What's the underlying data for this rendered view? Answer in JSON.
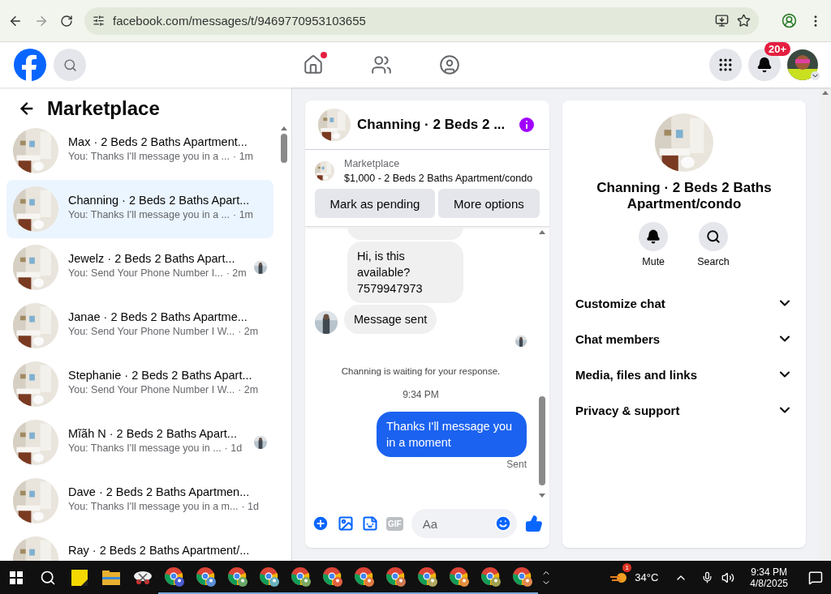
{
  "browser": {
    "url": "facebook.com/messages/t/9469770953103655"
  },
  "header": {
    "nav": [
      {
        "kind": "home",
        "selected": false,
        "dot": true
      },
      {
        "kind": "friends",
        "selected": false,
        "dot": false
      },
      {
        "kind": "groups",
        "selected": false,
        "dot": false
      }
    ],
    "notification_badge": "20+"
  },
  "sidebar": {
    "title": "Marketplace",
    "conversations": [
      {
        "name": "Max · 2 Beds 2 Baths Apartment...",
        "preview": "You: Thanks I'll message you in a ...",
        "time": "· 1m",
        "selected": false,
        "seen": false
      },
      {
        "name": "Channing · 2 Beds 2 Baths Apart...",
        "preview": "You: Thanks I'll message you in a ...",
        "time": "· 1m",
        "selected": true,
        "seen": false
      },
      {
        "name": "Jewelz · 2 Beds 2 Baths Apart...",
        "preview": "You: Send Your Phone Number I...",
        "time": "· 2m",
        "selected": false,
        "seen": true
      },
      {
        "name": "Janae · 2 Beds 2 Baths Apartme...",
        "preview": "You: Send Your Phone Number I W...",
        "time": "· 2m",
        "selected": false,
        "seen": false
      },
      {
        "name": "Stephanie · 2 Beds 2 Baths Apart...",
        "preview": "You: Send Your Phone Number I W...",
        "time": "· 2m",
        "selected": false,
        "seen": false
      },
      {
        "name": "Mĩãh N · 2 Beds 2 Baths Apart...",
        "preview": "You: Thanks I'll message you in ...",
        "time": "· 1d",
        "selected": false,
        "seen": true
      },
      {
        "name": "Dave · 2 Beds 2 Baths Apartmen...",
        "preview": "You: Thanks I'll message you in a m...",
        "time": "· 1d",
        "selected": false,
        "seen": false
      },
      {
        "name": "Ray · 2 Beds 2 Baths Apartment/...",
        "selected": false,
        "seen": false
      }
    ]
  },
  "chat": {
    "title": "Channing · 2 Beds 2 ...",
    "listing": {
      "label": "Marketplace",
      "text": "$1,000 - 2 Beds 2 Baths Apartment/condo"
    },
    "actions": [
      "Mark as pending",
      "More options"
    ],
    "messages": [
      {
        "kind": "partial"
      },
      {
        "kind": "incoming",
        "text": "Hi, is this available? 7579947973",
        "avatar": false
      },
      {
        "kind": "incoming",
        "text": "Message sent",
        "avatar": true
      },
      {
        "kind": "seen"
      },
      {
        "kind": "system",
        "text": "Channing is waiting for your response."
      },
      {
        "kind": "time",
        "text": "9:34 PM"
      },
      {
        "kind": "outgoing",
        "text": "Thanks I'll message you in a moment"
      },
      {
        "kind": "status",
        "text": "Sent"
      }
    ],
    "composer": {
      "gif": "GIF",
      "placeholder": "Aa"
    }
  },
  "details": {
    "title": "Channing · 2 Beds 2 Baths Apartment/condo",
    "actions": [
      {
        "kind": "mute",
        "label": "Mute"
      },
      {
        "kind": "search",
        "label": "Search"
      }
    ],
    "sections": [
      {
        "label": "Customize chat",
        "expanded": false
      },
      {
        "label": "Chat members",
        "expanded": false
      },
      {
        "label": "Media, files and links",
        "expanded": false
      },
      {
        "label": "Privacy & support",
        "expanded": false
      }
    ]
  },
  "taskbar": {
    "weather_badge": "1",
    "temperature": "34°C",
    "time": "9:34 PM",
    "date": "4/8/2025",
    "apps": [
      {
        "kind": "notes"
      },
      {
        "kind": "folder"
      },
      {
        "kind": "snip"
      },
      {
        "kind": "chrome",
        "color": "#4a5bd0"
      },
      {
        "kind": "chrome",
        "color": "#5b8fd6"
      },
      {
        "kind": "chrome",
        "color": "#6aa86a"
      },
      {
        "kind": "chrome",
        "color": "#6ab0c0"
      },
      {
        "kind": "chrome",
        "color": "#7aa860"
      },
      {
        "kind": "chrome",
        "color": "#e06040"
      },
      {
        "kind": "chrome",
        "color": "#e07a40"
      },
      {
        "kind": "chrome",
        "color": "#d07850"
      },
      {
        "kind": "chrome",
        "color": "#b0a860"
      },
      {
        "kind": "chrome",
        "color": "#e09040"
      },
      {
        "kind": "chrome",
        "color": "#a0a050"
      },
      {
        "kind": "chrome",
        "color": "#e08a50"
      }
    ]
  }
}
